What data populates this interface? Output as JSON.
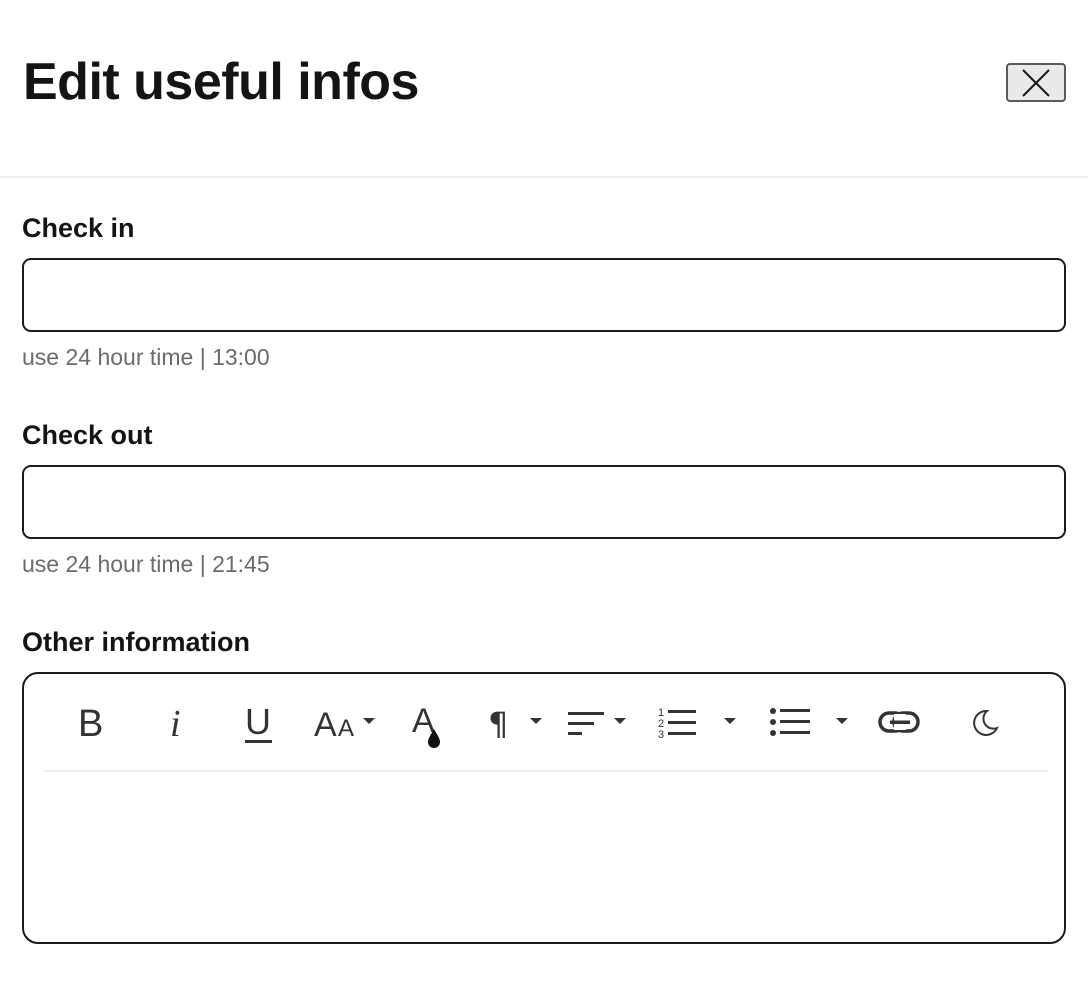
{
  "dialog": {
    "title": "Edit useful infos",
    "close_icon": "close-icon"
  },
  "fields": {
    "check_in": {
      "label": "Check in",
      "value": "",
      "hint": "use 24 hour time | 13:00"
    },
    "check_out": {
      "label": "Check out",
      "value": "",
      "hint": "use 24 hour time | 21:45"
    },
    "other": {
      "label": "Other information",
      "content": ""
    }
  },
  "toolbar": {
    "tools": [
      "bold-icon",
      "italic-icon",
      "underline-icon",
      "font-size-icon",
      "text-color-icon",
      "paragraph-icon",
      "align-icon",
      "ordered-list-icon",
      "unordered-list-icon",
      "link-icon",
      "dark-mode-icon"
    ]
  },
  "colors": {
    "text": "#141414",
    "border": "#1a1a1a",
    "hint": "#6b6b6b",
    "divider": "#ececec"
  }
}
